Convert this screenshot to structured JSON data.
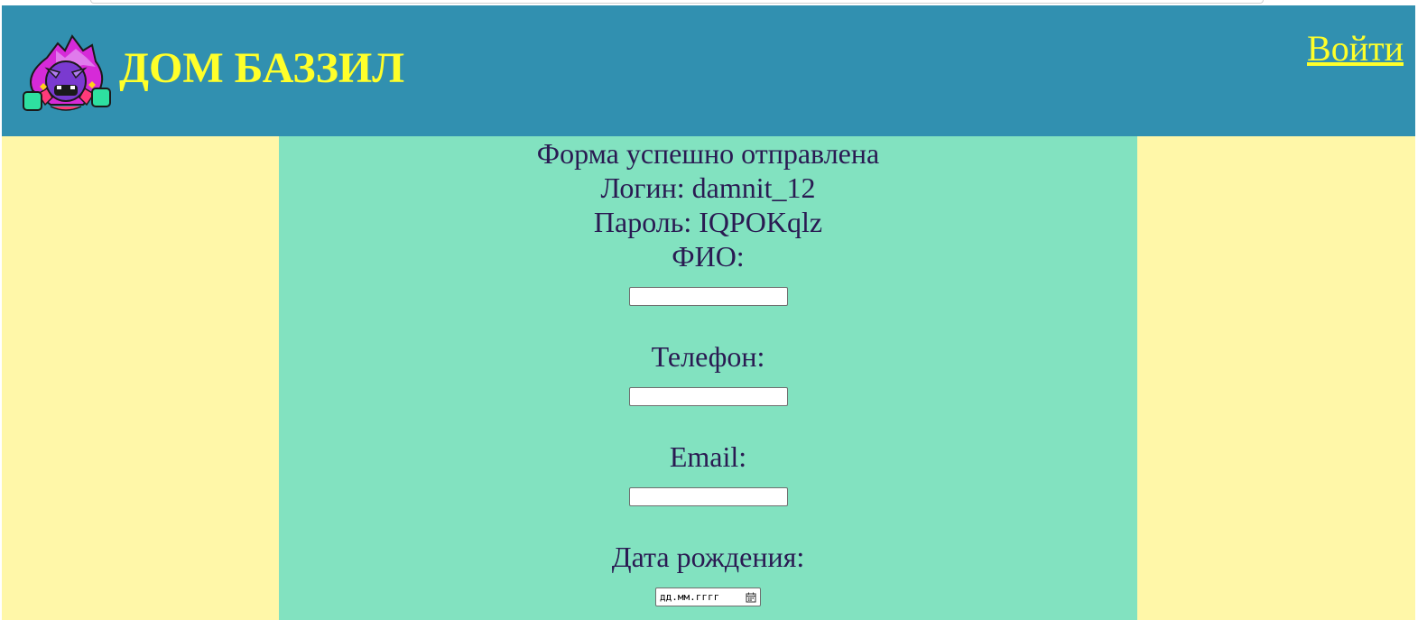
{
  "header": {
    "site_title": "ДОМ БАЗЗИЛ",
    "login_link": "Войти",
    "logo_icon": "brawler-mascot-logo"
  },
  "form_result": {
    "status": "Форма успешно отправлена",
    "login_line": "Логин: damnit_12",
    "password_line": "Пароль: IQPOKqlz"
  },
  "form": {
    "fio_label": "ФИО:",
    "fio_value": "",
    "phone_label": "Телефон:",
    "phone_value": "",
    "email_label": "Email:",
    "email_value": "",
    "birthdate_label": "Дата рождения:",
    "birthdate_placeholder": "дд.мм.гггг"
  },
  "colors": {
    "header_bg": "#3190b0",
    "accent_yellow": "#ffff2a",
    "side_bg": "#fff7a8",
    "main_bg": "#82e2c0",
    "text": "#2a1a52"
  }
}
